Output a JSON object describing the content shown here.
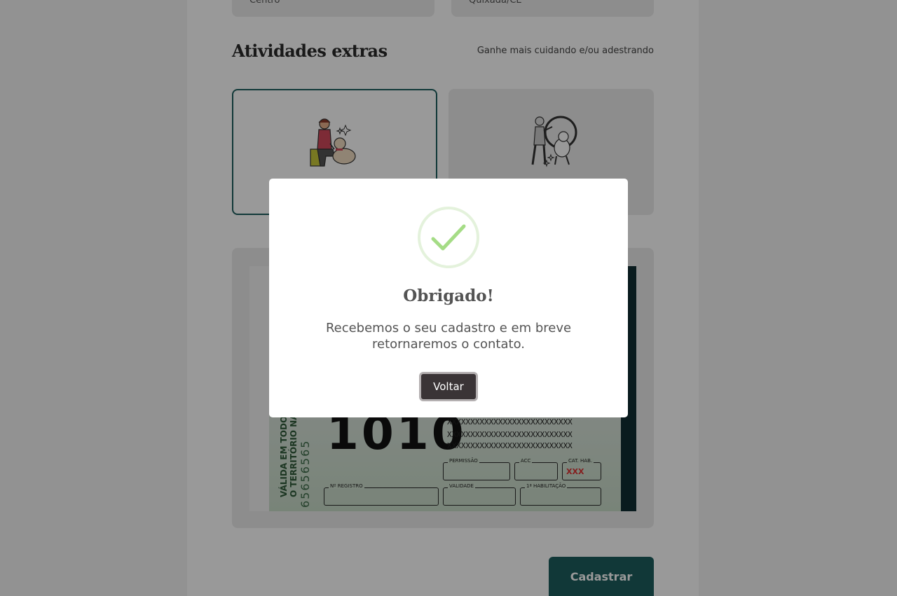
{
  "form": {
    "field_left_value": "Centro",
    "field_right_value": "Quixadá/CE",
    "section_title": "Atividades extras",
    "section_subtitle": "Ganhe mais cuidando e/ou adestrando",
    "activity_cards": [
      {
        "icon": "pet-grooming-illustration",
        "selected": true
      },
      {
        "icon": "dog-training-hoop-illustration",
        "selected": false
      }
    ],
    "submit_label": "Cadastrar"
  },
  "license_image": {
    "side_text_line1": "VÁLIDA EM TODO",
    "side_text_line2": "O TERRITÓRIO NACIONAL",
    "side_number": "65656565",
    "big_number": "1010",
    "x_row": "XXXXXXXXXXXXXXXXXXXXXXXXXXX",
    "field_permissao": "PERMISSÃO",
    "field_acc": "ACC",
    "field_cat_hab": "CAT. HAB.",
    "cat_hab_value": "XXX",
    "field_registro": "Nº REGISTRO",
    "field_validade": "VALIDADE",
    "field_habilitacao": "1ª HABILITAÇÃO"
  },
  "modal": {
    "icon": "success-check-icon",
    "title": "Obrigado!",
    "message": "Recebemos o seu cadastro e em breve retornaremos o contato.",
    "button_label": "Voltar"
  },
  "colors": {
    "accent": "#1d5e5e",
    "check": "#a5dc86",
    "modal_button": "#3a3436"
  }
}
